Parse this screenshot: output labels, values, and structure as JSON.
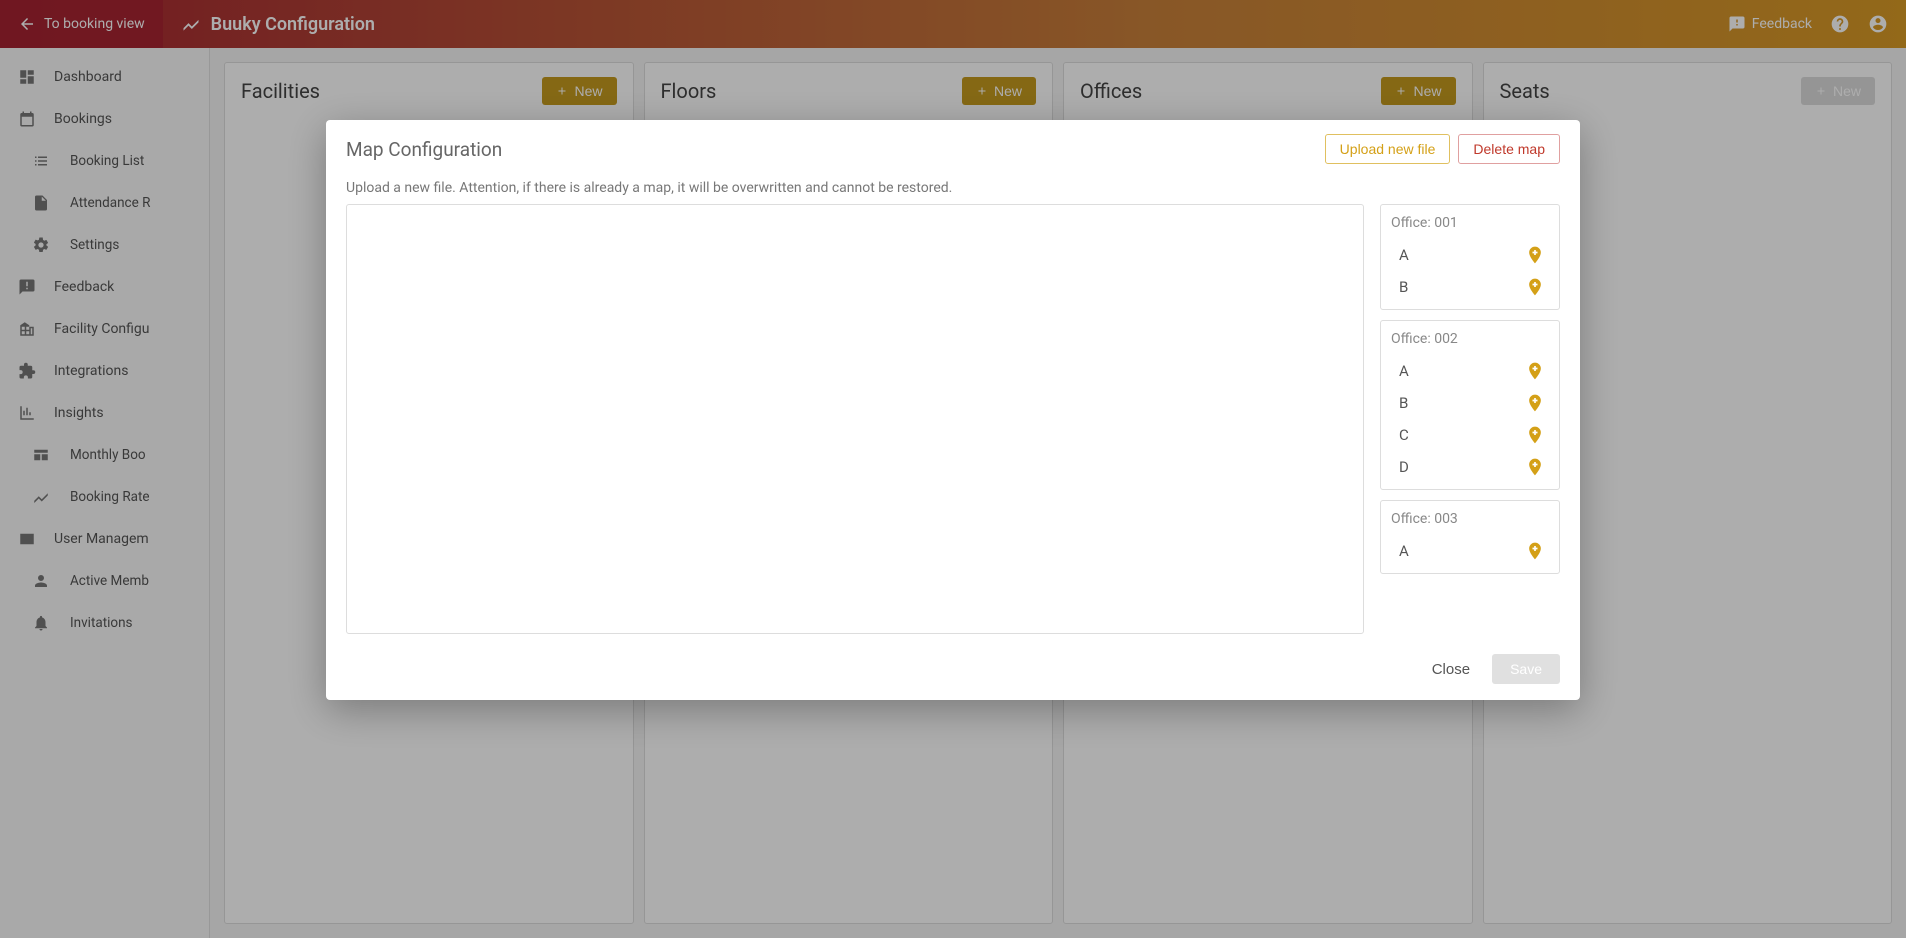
{
  "topbar": {
    "back_label": "To booking view",
    "title": "Buuky Configuration",
    "feedback_label": "Feedback"
  },
  "sidebar": {
    "dashboard": "Dashboard",
    "bookings": "Bookings",
    "booking_list": "Booking List",
    "attendance": "Attendance R",
    "settings": "Settings",
    "feedback": "Feedback",
    "facility_config": "Facility Configu",
    "integrations": "Integrations",
    "insights": "Insights",
    "monthly_book": "Monthly Boo",
    "booking_rate": "Booking Rate",
    "user_management": "User Managem",
    "active_members": "Active Memb",
    "invitations": "Invitations"
  },
  "columns": {
    "facilities": {
      "title": "Facilities",
      "new": "New"
    },
    "floors": {
      "title": "Floors",
      "new": "New"
    },
    "offices": {
      "title": "Offices",
      "new": "New"
    },
    "seats": {
      "title": "Seats",
      "new": "New"
    }
  },
  "modal": {
    "title": "Map Configuration",
    "upload": "Upload new file",
    "delete": "Delete map",
    "subtitle": "Upload a new file. Attention, if there is already a map, it will be overwritten and cannot be restored.",
    "offices": [
      {
        "name": "Office: 001",
        "seats": [
          "A",
          "B"
        ]
      },
      {
        "name": "Office: 002",
        "seats": [
          "A",
          "B",
          "C",
          "D"
        ]
      },
      {
        "name": "Office: 003",
        "seats": [
          "A"
        ]
      }
    ],
    "close": "Close",
    "save": "Save"
  }
}
